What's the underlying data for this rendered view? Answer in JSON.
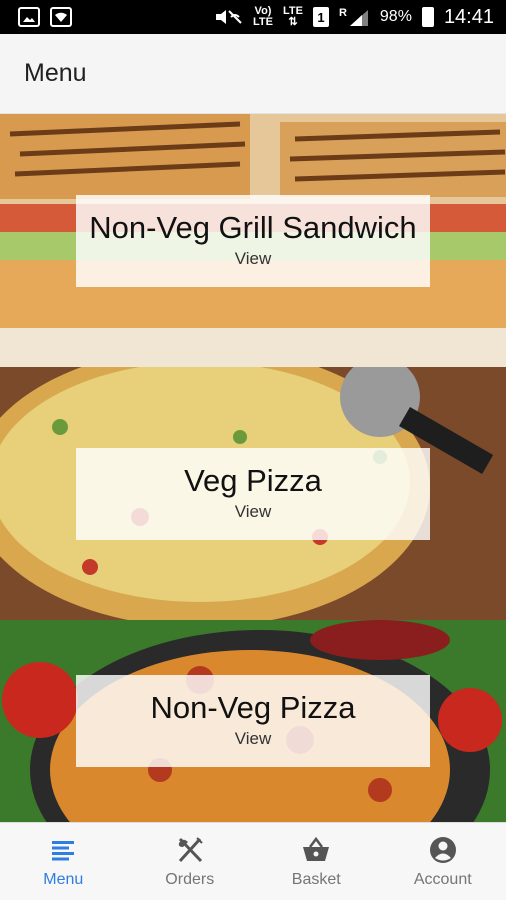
{
  "status_bar": {
    "volte_top": "Vo)",
    "volte_bottom": "LTE",
    "lte_top": "LTE",
    "lte_bottom": "⇅",
    "sim_slot": "1",
    "roaming": "R",
    "battery": "98%",
    "time": "14:41"
  },
  "app_bar": {
    "title": "Menu"
  },
  "menu": [
    {
      "title": "Non-Veg Grill Sandwich",
      "action": "View"
    },
    {
      "title": "Veg Pizza",
      "action": "View"
    },
    {
      "title": "Non-Veg Pizza",
      "action": "View"
    }
  ],
  "bottom_nav": [
    {
      "label": "Menu",
      "icon": "menu-list-icon",
      "active": true
    },
    {
      "label": "Orders",
      "icon": "fork-knife-icon",
      "active": false
    },
    {
      "label": "Basket",
      "icon": "basket-icon",
      "active": false
    },
    {
      "label": "Account",
      "icon": "account-circle-icon",
      "active": false
    }
  ],
  "colors": {
    "accent": "#2f7de1",
    "inactive": "#757575",
    "app_bar": "#f5f5f5"
  }
}
